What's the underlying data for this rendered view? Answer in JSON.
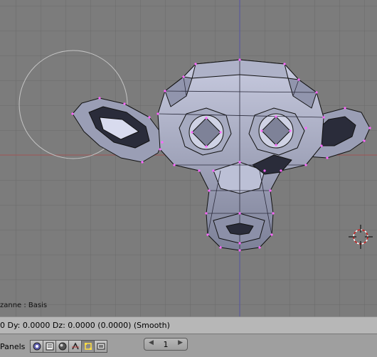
{
  "viewport": {
    "object_label": "zanne : Basis"
  },
  "status_bar": {
    "text": "0   Dy: 0.0000   Dz: 0.0000 (0.0000) (Smooth)"
  },
  "panels_bar": {
    "label": "Panels",
    "buttons": [
      {
        "icon": "logic-icon"
      },
      {
        "icon": "script-icon"
      },
      {
        "icon": "shading-icon"
      },
      {
        "icon": "object-icon"
      },
      {
        "icon": "editing-icon",
        "active": true
      },
      {
        "icon": "scene-icon"
      }
    ],
    "page_stepper": {
      "value": "1",
      "prev": "◀",
      "next": "▶"
    }
  }
}
